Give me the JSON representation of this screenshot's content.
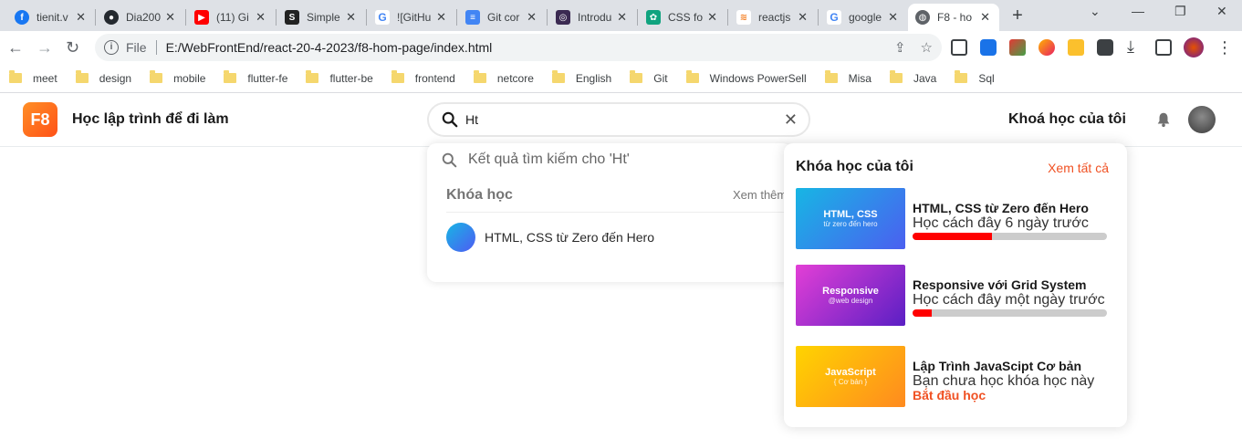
{
  "browser": {
    "tabs": [
      {
        "label": "tienit.v",
        "icon": "facebook-icon",
        "color": "#1877f2"
      },
      {
        "label": "Dia200",
        "icon": "github-icon",
        "color": "#24292f"
      },
      {
        "label": "(11) Gi",
        "icon": "youtube-icon",
        "color": "#ff0000"
      },
      {
        "label": "Simple",
        "icon": "site-icon",
        "color": "#222222"
      },
      {
        "label": "![GitHu",
        "icon": "google-icon",
        "color": "#4285f4"
      },
      {
        "label": "Git cor",
        "icon": "docs-icon",
        "color": "#4285f4"
      },
      {
        "label": "Introdu",
        "icon": "openai-icon",
        "color": "#6a4c93"
      },
      {
        "label": "CSS fo",
        "icon": "chatgpt-icon",
        "color": "#10a37f"
      },
      {
        "label": "reactjs",
        "icon": "stackoverflow-icon",
        "color": "#f48024"
      },
      {
        "label": "google",
        "icon": "google-icon",
        "color": "#4285f4"
      },
      {
        "label": "F8 - ho",
        "icon": "globe-icon",
        "color": "#5f6368"
      }
    ],
    "url_scheme": "File",
    "url": "E:/WebFrontEnd/react-20-4-2023/f8-hom-page/index.html",
    "bookmarks": [
      "meet",
      "design",
      "mobile",
      "flutter-fe",
      "flutter-be",
      "frontend",
      "netcore",
      "English",
      "Git",
      "Windows PowerSell",
      "Misa",
      "Java",
      "Sql"
    ]
  },
  "header": {
    "logo": "F8",
    "brand": "Học lập trình để đi làm",
    "search_value": "Ht",
    "my_courses": "Khoá học của tôi"
  },
  "search_results": {
    "heading": "Kết quả tìm kiếm cho 'Ht'",
    "category": "Khóa học",
    "see_more": "Xem thêm",
    "items": [
      {
        "title": "HTML, CSS từ Zero đến Hero"
      }
    ]
  },
  "my_courses": {
    "title": "Khóa học của tôi",
    "see_all": "Xem tất cả",
    "courses": [
      {
        "thumb_title": "HTML, CSS",
        "thumb_sub": "từ zero đến hero",
        "name": "HTML, CSS từ Zero đến Hero",
        "meta": "Học cách đây 6 ngày trước",
        "progress": 0.41
      },
      {
        "thumb_title": "Responsive",
        "thumb_sub": "@web design",
        "name": "Responsive với Grid System",
        "meta": "Học cách đây một ngày trước",
        "progress": 0.1
      },
      {
        "thumb_title": "JavaScript",
        "thumb_sub": "{ Cơ bản }",
        "name": "Lập Trình JavaScipt Cơ bản",
        "meta": "Bạn chưa học khóa học này",
        "start": "Bắt đầu học"
      }
    ]
  },
  "colors": {
    "accent": "#f05123",
    "progress": "#ff0000"
  }
}
